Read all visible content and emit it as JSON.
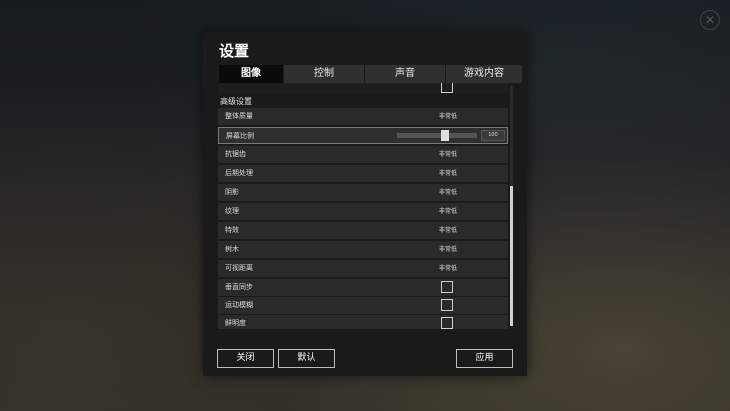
{
  "dialog": {
    "title": "设置"
  },
  "tabs": [
    {
      "label": "图像",
      "active": true
    },
    {
      "label": "控制",
      "active": false
    },
    {
      "label": "声音",
      "active": false
    },
    {
      "label": "游戏内容",
      "active": false
    }
  ],
  "section": {
    "advanced_header": "高级设置"
  },
  "settings": {
    "overall_quality": {
      "label": "整体质量",
      "value": "非常低"
    },
    "screen_scale": {
      "label": "屏幕比例",
      "value": "100",
      "slider_fraction": 0.6
    },
    "anti_aliasing": {
      "label": "抗锯齿",
      "value": "非常低"
    },
    "post_processing": {
      "label": "后期处理",
      "value": "非常低"
    },
    "shadows": {
      "label": "阴影",
      "value": "非常低"
    },
    "textures": {
      "label": "纹理",
      "value": "非常低"
    },
    "effects": {
      "label": "特效",
      "value": "非常低"
    },
    "foliage": {
      "label": "树木",
      "value": "非常低"
    },
    "view_distance": {
      "label": "可视距离",
      "value": "非常低"
    },
    "vsync": {
      "label": "垂直同步",
      "checked": false
    },
    "motion_blur": {
      "label": "运动模糊",
      "checked": false
    },
    "sharpness": {
      "label": "鲜明度",
      "checked": false
    }
  },
  "footer": {
    "close_label": "关闭",
    "default_label": "默认",
    "apply_label": "应用"
  },
  "icons": {
    "top_right": "close-icon"
  },
  "colors": {
    "dialog_bg": "#1a1a1a",
    "row_bg": "#2a2a2a",
    "active_tab_bg": "#0a0a0a",
    "inactive_tab_bg": "#303030"
  }
}
